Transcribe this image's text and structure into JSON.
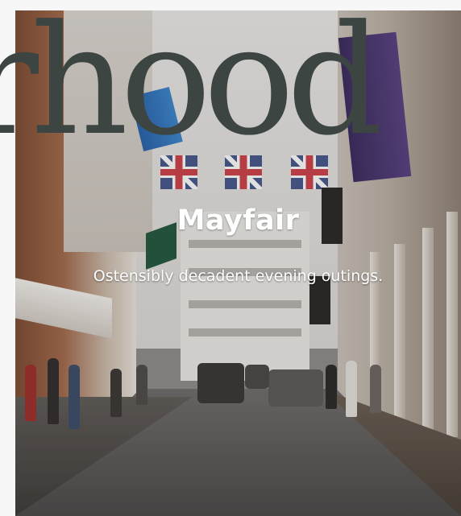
{
  "hero": {
    "background_word": "orhood",
    "title": "Mayfair",
    "subtitle": "Ostensibly decadent evening outings.",
    "image_alt": "mayfair-street-photo"
  },
  "colors": {
    "page_background": "#f7f7f7",
    "background_word": "#3d4542",
    "title_text": "#ffffff"
  }
}
